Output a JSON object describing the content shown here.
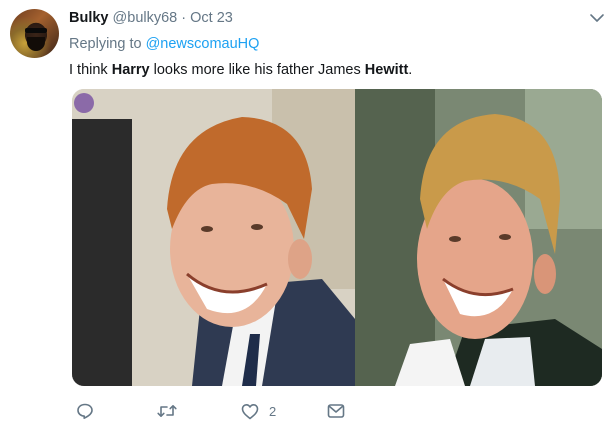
{
  "tweet": {
    "author_name": "Bulky",
    "handle": "@bulky68",
    "separator": "·",
    "date": "Oct 23",
    "replying_prefix": "Replying to",
    "replying_to": "@newscomauHQ",
    "text_parts": [
      "I think ",
      "Harry",
      " looks more like his father James ",
      "Hewitt",
      "."
    ],
    "like_count": "2"
  },
  "colors": {
    "text": "#14171a",
    "muted": "#657786",
    "link": "#1da1f2"
  },
  "icons": {
    "reply": "reply-icon",
    "retweet": "retweet-icon",
    "like": "heart-icon",
    "message": "envelope-icon",
    "menu": "chevron-down-icon"
  }
}
